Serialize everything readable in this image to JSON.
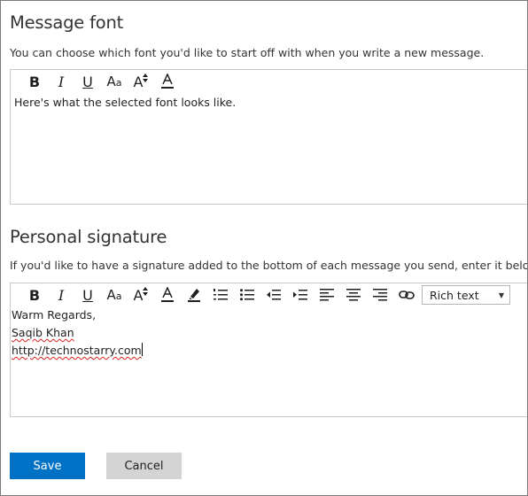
{
  "message_font": {
    "heading": "Message font",
    "description": "You can choose which font you'd like to start off with when you write a new message.",
    "preview_text": "Here's what the selected font looks like.",
    "toolbar": {
      "bold": "B",
      "italic": "I",
      "underline": "U",
      "font_size_big": "A",
      "font_size_small": "a",
      "grow": "A"
    }
  },
  "personal_signature": {
    "heading": "Personal signature",
    "description": "If you'd like to have a signature added to the bottom of each message you send, enter it below.",
    "toolbar": {
      "bold": "B",
      "italic": "I",
      "underline": "U",
      "font_size_big": "A",
      "font_size_small": "a",
      "grow": "A",
      "format_mode": "Rich text"
    },
    "signature_lines": [
      "Warm Regards,",
      "Saqib Khan",
      "http://technostarry.com"
    ]
  },
  "buttons": {
    "save": "Save",
    "cancel": "Cancel"
  },
  "colors": {
    "accent": "#0072c6",
    "cancel_bg": "#d4d4d4",
    "border": "#c8c8c8",
    "spell_error": "#e02020"
  },
  "icons": [
    "bold-icon",
    "italic-icon",
    "underline-icon",
    "font-size-icon",
    "grow-font-icon",
    "font-color-icon",
    "highlight-icon",
    "numbered-list-icon",
    "bulleted-list-icon",
    "decrease-indent-icon",
    "increase-indent-icon",
    "align-left-icon",
    "align-center-icon",
    "align-right-icon",
    "link-icon",
    "chevron-down-icon"
  ]
}
